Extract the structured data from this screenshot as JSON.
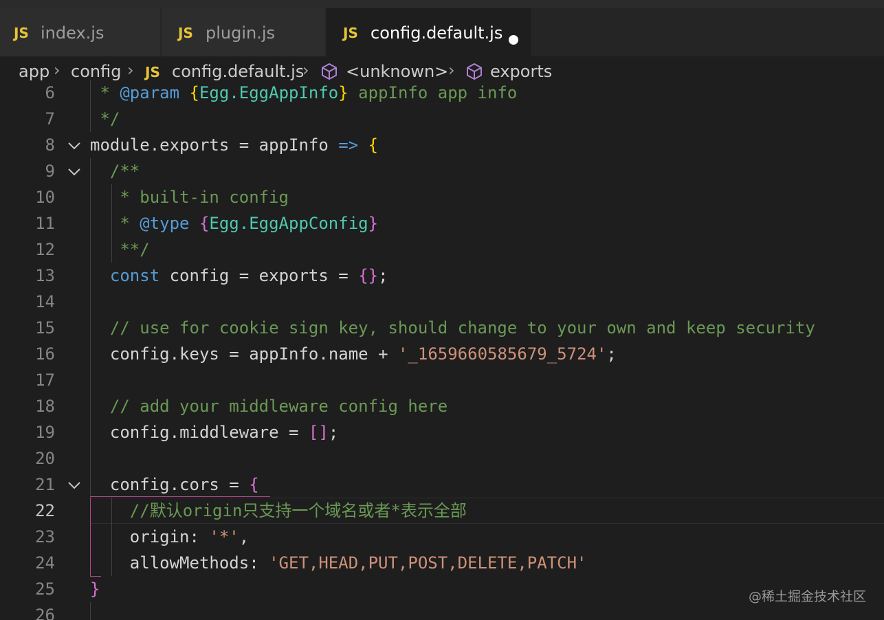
{
  "tabs": [
    {
      "icon": "JS",
      "label": "index.js"
    },
    {
      "icon": "JS",
      "label": "plugin.js"
    },
    {
      "icon": "JS",
      "label": "config.default.js",
      "modified": true
    }
  ],
  "breadcrumb": {
    "items": [
      "app",
      "config",
      "config.default.js",
      "<unknown>",
      "exports"
    ],
    "file_icon": "JS"
  },
  "editor": {
    "active_line": 22,
    "line_numbers": [
      "6",
      "7",
      "8",
      "9",
      "10",
      "11",
      "12",
      "13",
      "14",
      "15",
      "16",
      "17",
      "18",
      "19",
      "20",
      "21",
      "22",
      "23",
      "24",
      "25",
      "26"
    ],
    "lines": {
      "l6": {
        "a": " * ",
        "b": "@param",
        "c": " ",
        "d": "{",
        "e": "Egg.EggAppInfo",
        "f": "}",
        "g": " appInfo app info"
      },
      "l7": " */",
      "l8": {
        "a": "module",
        "b": ".",
        "c": "exports",
        "d": " = ",
        "e": "appInfo",
        "f": " ",
        "g": "=>",
        "h": " ",
        "i": "{"
      },
      "l9": "  /**",
      "l10": "   * built-in config",
      "l11": {
        "a": "   * ",
        "b": "@type",
        "c": " ",
        "d": "{",
        "e": "Egg.EggAppConfig",
        "f": "}"
      },
      "l12": "   **/",
      "l13": {
        "a": "  ",
        "b": "const",
        "c": " ",
        "d": "config",
        "e": " = ",
        "f": "exports",
        "g": " = ",
        "h": "{}",
        "i": ";"
      },
      "l15": "  // use for cookie sign key, should change to your own and keep security",
      "l16": {
        "a": "  ",
        "b": "config",
        "c": ".",
        "d": "keys",
        "e": " = ",
        "f": "appInfo",
        "g": ".",
        "h": "name",
        "i": " + ",
        "j": "'_1659660585679_5724'",
        "k": ";"
      },
      "l18": "  // add your middleware config here",
      "l19": {
        "a": "  ",
        "b": "config",
        "c": ".",
        "d": "middleware",
        "e": " = ",
        "f": "[]",
        "g": ";"
      },
      "l21": {
        "a": "  ",
        "b": "config",
        "c": ".",
        "d": "cors",
        "e": " = ",
        "f": "{"
      },
      "l22": "    //默认origin只支持一个域名或者*表示全部",
      "l23": {
        "a": "    ",
        "b": "origin",
        "c": ": ",
        "d": "'*'",
        "e": ","
      },
      "l24": {
        "a": "    ",
        "b": "allowMethods",
        "c": ": ",
        "d": "'GET,HEAD,PUT,POST,DELETE,PATCH'"
      },
      "l25": "}"
    }
  },
  "watermark": "@稀土掘金技术社区",
  "colors": {
    "background": "#1e1e1e",
    "comment": "#6a9955",
    "keyword": "#569cd6",
    "variable": "#9cdcfe",
    "string": "#ce9178",
    "type": "#4ec9b0",
    "brace_level1": "#ffd700",
    "brace_level2": "#da70d6",
    "js_icon": "#e8c538"
  }
}
